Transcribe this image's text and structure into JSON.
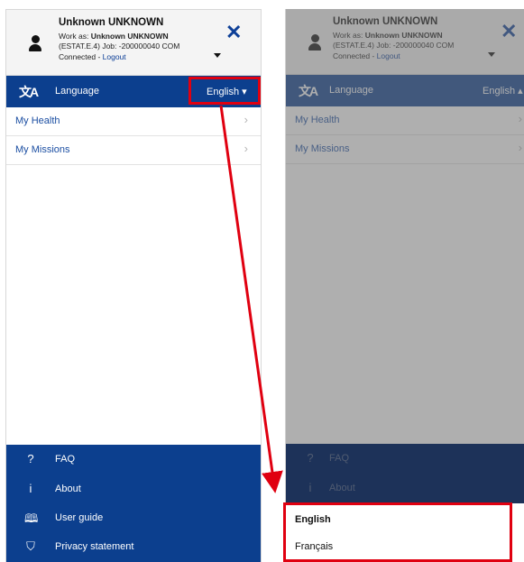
{
  "user": {
    "name": "Unknown UNKNOWN",
    "work_as_prefix": "Work as: ",
    "work_as_name": "Unknown UNKNOWN",
    "job_line": "(ESTAT.E.4) Job: -200000040 COM",
    "connected_prefix": "Connected - ",
    "logout": "Logout"
  },
  "close_symbol": "✕",
  "language": {
    "icon": "文A",
    "label": "Language",
    "value": "English",
    "caret_closed": "▾",
    "caret_open": "▴"
  },
  "menu": [
    {
      "label": "My Health"
    },
    {
      "label": "My Missions"
    }
  ],
  "chevron": "›",
  "footer": [
    {
      "icon": "?",
      "label": "FAQ"
    },
    {
      "icon": "i",
      "label": "About"
    },
    {
      "icon": "🕮",
      "label": "User guide"
    },
    {
      "icon": "⛉",
      "label": "Privacy statement"
    }
  ],
  "dropdown": {
    "options": [
      "English",
      "Français"
    ],
    "selected": "English"
  },
  "colors": {
    "primary": "#0c3f8e",
    "link": "#1b4ea2",
    "annotation": "#e00010"
  },
  "icons": {
    "avatar": "user-icon",
    "close": "close-icon",
    "language": "translate-icon",
    "chevron": "chevron-right-icon",
    "footer": [
      "question-icon",
      "info-icon",
      "book-icon",
      "shield-icon"
    ]
  }
}
